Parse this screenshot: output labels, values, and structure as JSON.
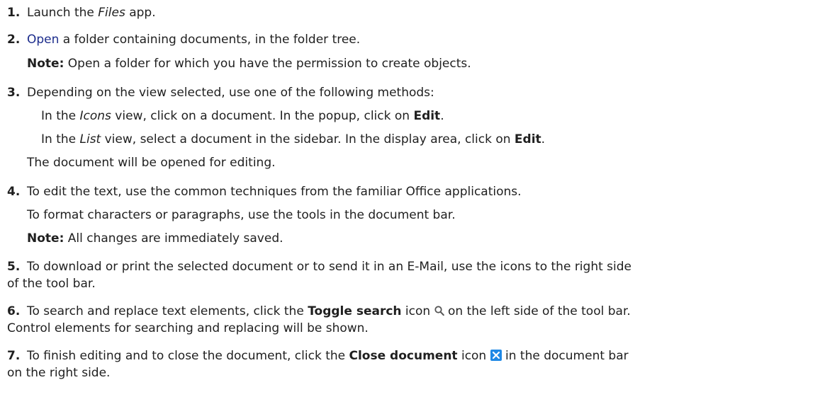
{
  "steps": [
    {
      "num": "1.",
      "pre": "Launch the ",
      "app": "Files",
      "post": " app."
    },
    {
      "num": "2.",
      "link": "Open",
      "text": " a folder containing documents, in the folder tree.",
      "note_label": "Note:",
      "note_text": " Open a folder for which you have the permission to create objects."
    },
    {
      "num": "3.",
      "text": "Depending on the view selected, use one of the following methods:",
      "a_pre": "In the ",
      "a_view": "Icons",
      "a_mid": " view, click on a document. In the popup, click on ",
      "a_action": "Edit",
      "a_post": ".",
      "b_pre": "In the ",
      "b_view": "List",
      "b_mid": " view, select a document in the sidebar. In the display area, click on ",
      "b_action": "Edit",
      "b_post": ".",
      "result": "The document will be opened for editing."
    },
    {
      "num": "4.",
      "text": "To edit the text, use the common techniques from the familiar Office applications.",
      "text2": "To format characters or paragraphs, use the tools in the document bar.",
      "note_label": "Note:",
      "note_text": " All changes are immediately saved."
    },
    {
      "num": "5.",
      "text": "To download or print the selected document or to send it in an E-Mail, use the icons to the right side",
      "text_cont": "of the tool bar."
    },
    {
      "num": "6.",
      "pre": "To search and replace text elements, click the ",
      "bold": "Toggle search",
      "mid": " icon ",
      "post": " on the left side of the tool bar.",
      "text_cont": "Control elements for searching and replacing will be shown."
    },
    {
      "num": "7.",
      "pre": "To finish editing and to close the document, click the ",
      "bold": "Close document",
      "mid": " icon ",
      "post": " in the document bar",
      "text_cont": "on the right side."
    }
  ],
  "colors": {
    "link": "#1c2c8c",
    "close_icon": "#1e88e5",
    "search_icon": "#555555"
  },
  "icons": {
    "search": "magnifier-icon",
    "close": "close-x-icon"
  }
}
